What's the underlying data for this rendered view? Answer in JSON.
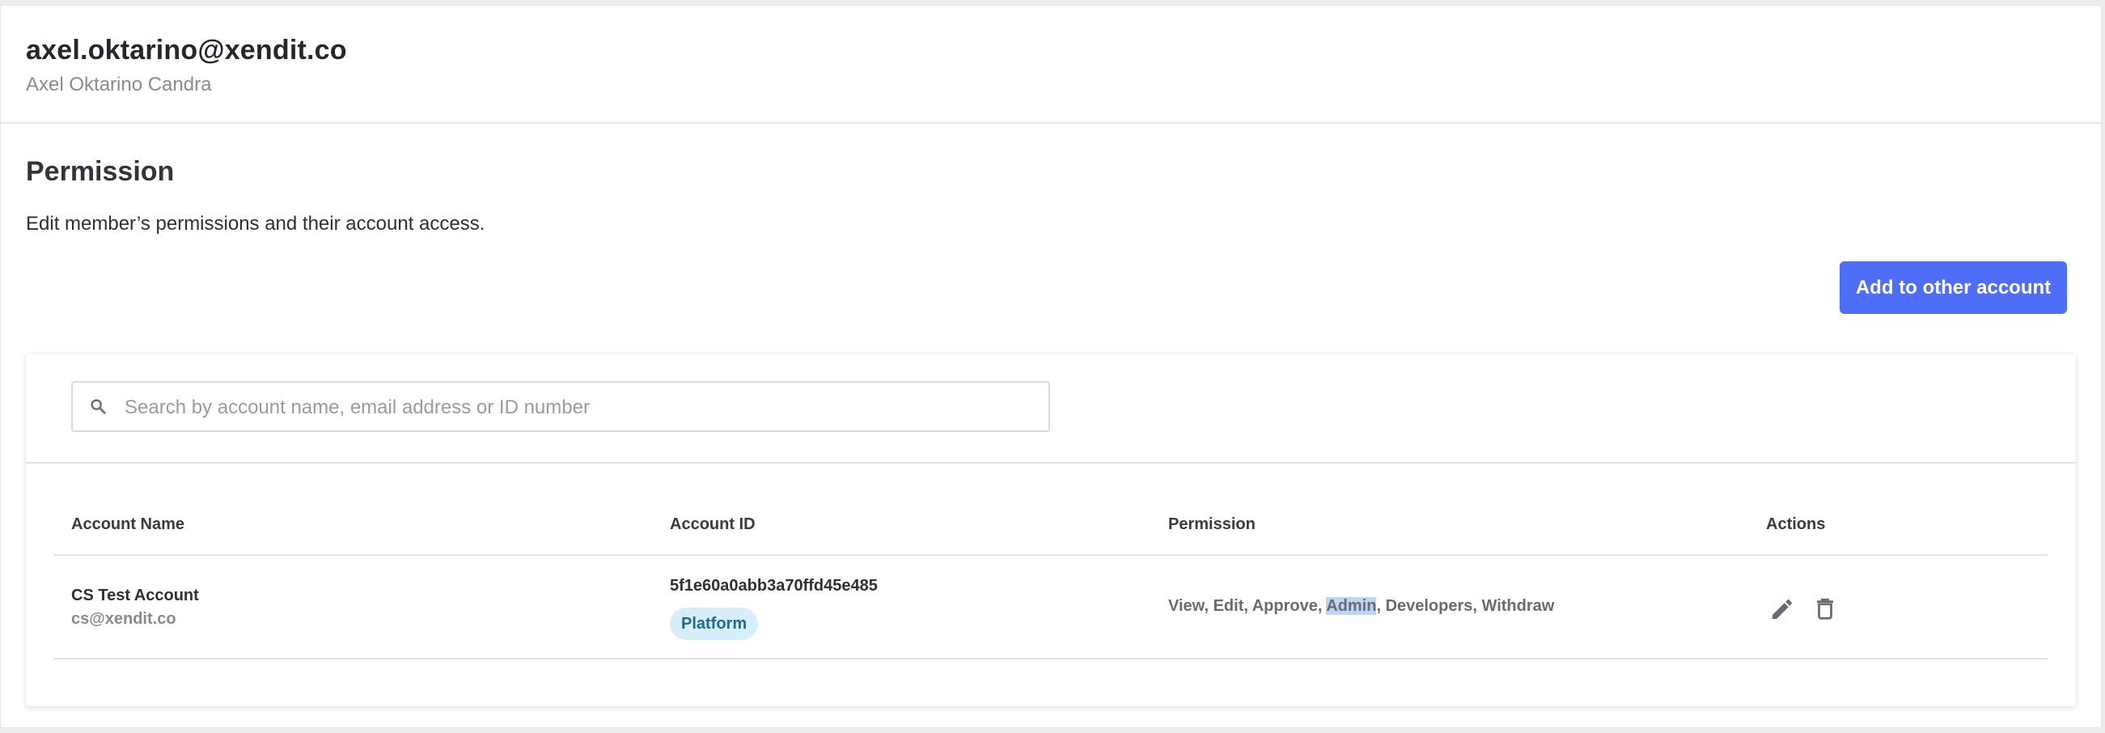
{
  "header": {
    "email": "axel.oktarino@xendit.co",
    "name": "Axel Oktarino Candra"
  },
  "permission_section": {
    "title": "Permission",
    "description": "Edit member’s permissions and their account access.",
    "add_button_label": "Add to other account"
  },
  "search": {
    "placeholder": "Search by account name, email address or ID number",
    "value": ""
  },
  "table": {
    "columns": [
      "Account Name",
      "Account ID",
      "Permission",
      "Actions"
    ],
    "rows": [
      {
        "account_name": "CS Test Account",
        "account_email": "cs@xendit.co",
        "account_id": "5f1e60a0abb3a70ffd45e485",
        "badge": "Platform",
        "permission_before": "View, Edit, Approve, ",
        "permission_highlight": "Admin",
        "permission_after": ", Developers, Withdraw"
      }
    ]
  },
  "colors": {
    "accent": "#4f6ef7",
    "badge_bg": "#d6effa",
    "badge_text": "#1f6a8e",
    "selection_highlight": "#bcd6f5"
  },
  "icons": {
    "search": "search-icon",
    "edit": "pencil-icon",
    "delete": "trash-icon"
  }
}
